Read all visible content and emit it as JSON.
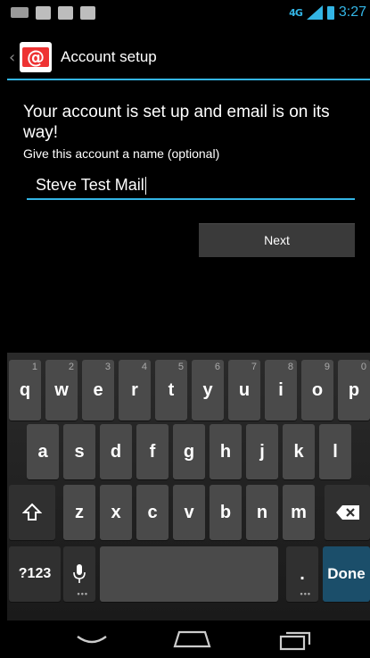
{
  "status_bar": {
    "network": "4G",
    "time": "3:27"
  },
  "action_bar": {
    "title": "Account setup"
  },
  "content": {
    "headline": "Your account is set up and email is on its way!",
    "name_label": "Give this account a name (optional)",
    "account_name_value": "Steve Test Mail",
    "next_label": "Next"
  },
  "keyboard": {
    "row1": [
      {
        "label": "q",
        "hint": "1"
      },
      {
        "label": "w",
        "hint": "2"
      },
      {
        "label": "e",
        "hint": "3"
      },
      {
        "label": "r",
        "hint": "4"
      },
      {
        "label": "t",
        "hint": "5"
      },
      {
        "label": "y",
        "hint": "6"
      },
      {
        "label": "u",
        "hint": "7"
      },
      {
        "label": "i",
        "hint": "8"
      },
      {
        "label": "o",
        "hint": "9"
      },
      {
        "label": "p",
        "hint": "0"
      }
    ],
    "row2": [
      "a",
      "s",
      "d",
      "f",
      "g",
      "h",
      "j",
      "k",
      "l"
    ],
    "row3": [
      "z",
      "x",
      "c",
      "v",
      "b",
      "n",
      "m"
    ],
    "symbols_label": "?123",
    "period_label": ".",
    "done_label": "Done"
  },
  "colors": {
    "accent": "#33b5e5",
    "background": "#000000",
    "key": "#4a4a4a",
    "done_key": "#1b4e6a"
  },
  "icons": {
    "app": "email-at-icon",
    "shift": "shift-icon",
    "backspace": "backspace-icon",
    "mic": "microphone-icon",
    "back": "nav-back-icon",
    "home": "nav-home-icon",
    "recent": "nav-recent-apps-icon"
  }
}
